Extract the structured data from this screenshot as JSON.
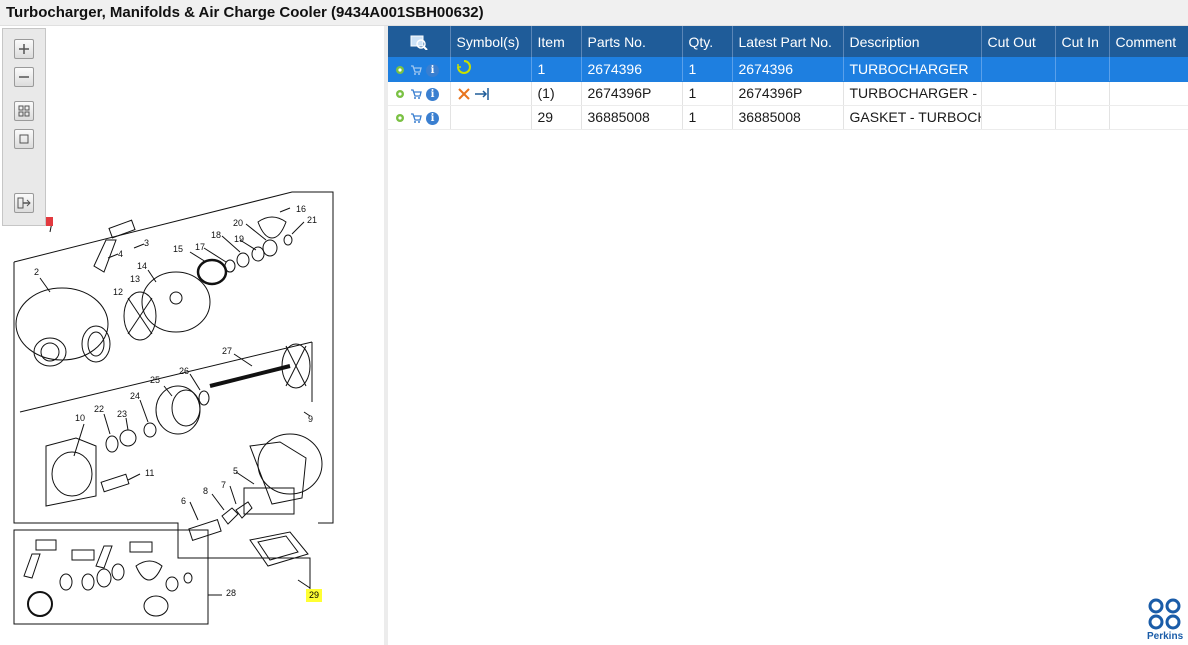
{
  "window": {
    "title": "Turbocharger, Manifolds & Air Charge Cooler (9434A001SBH00632)"
  },
  "zoom_toolbar": {
    "buttons": [
      "zoom-in",
      "zoom-out",
      "fit-all",
      "fit-page",
      "export"
    ]
  },
  "diagram": {
    "callouts": [
      "1",
      "2",
      "3",
      "4",
      "5",
      "6",
      "7",
      "8",
      "9",
      "10",
      "11",
      "12",
      "13",
      "14",
      "15",
      "16",
      "17",
      "18",
      "19",
      "20",
      "21",
      "22",
      "23",
      "24",
      "25",
      "26",
      "27",
      "28",
      "29"
    ],
    "highlighted_callout": "29"
  },
  "table": {
    "columns": [
      "",
      "Symbol(s)",
      "Item",
      "Parts No.",
      "Qty.",
      "Latest Part No.",
      "Description",
      "Cut Out",
      "Cut In",
      "Comment"
    ],
    "rows": [
      {
        "item": "1",
        "parts_no": "2674396",
        "qty": "1",
        "latest_part_no": "2674396",
        "description": "TURBOCHARGER",
        "cut_out": "",
        "cut_in": "",
        "comment": "",
        "selected": true
      },
      {
        "item": "(1)",
        "parts_no": "2674396P",
        "qty": "1",
        "latest_part_no": "2674396P",
        "description": "TURBOCHARGER - E",
        "cut_out": "",
        "cut_in": "",
        "comment": "",
        "selected": false
      },
      {
        "item": "29",
        "parts_no": "36885008",
        "qty": "1",
        "latest_part_no": "36885008",
        "description": "GASKET - TURBOCH",
        "cut_out": "",
        "cut_in": "",
        "comment": "",
        "selected": false
      }
    ]
  },
  "icons": {
    "header_first_col": "search-image-icon",
    "row_actions": [
      "gear-icon",
      "cart-icon",
      "info-icon"
    ],
    "row1_symbol": "recycle-icon",
    "row2_symbols": [
      "cross-icon",
      "supersede-icon"
    ]
  },
  "colors": {
    "header": "#1f5c99",
    "selected_row": "#1e7fe0",
    "highlight": "#ffff33",
    "brand": "#1a5ca8"
  },
  "brand": {
    "name": "Perkins"
  }
}
